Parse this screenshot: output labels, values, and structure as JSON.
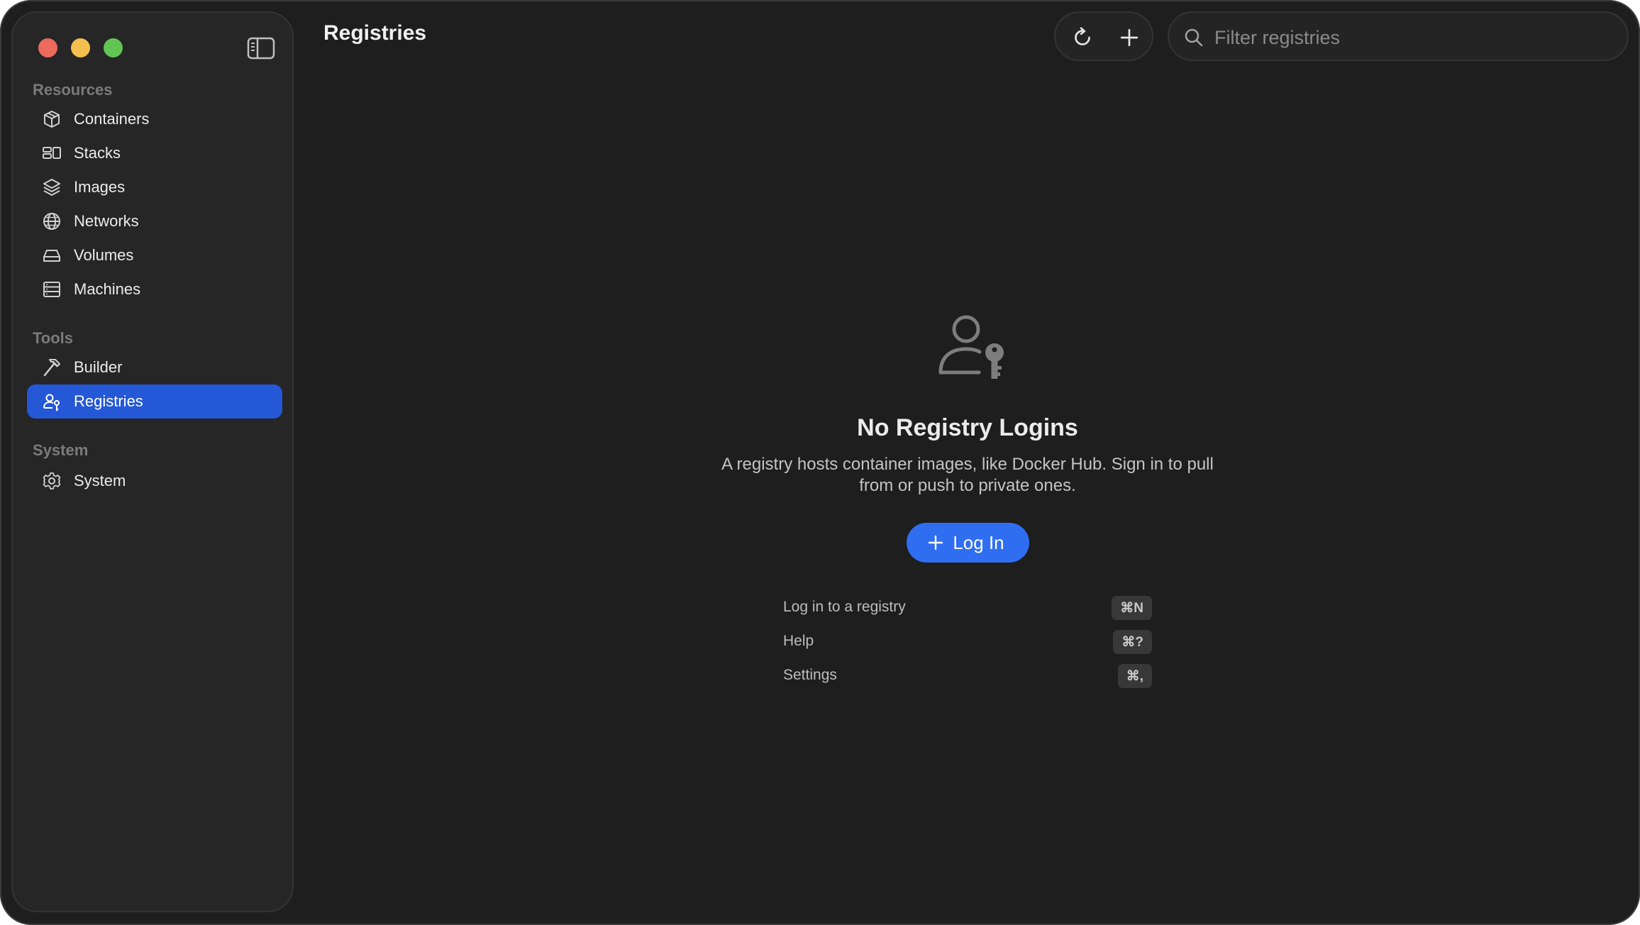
{
  "window": {
    "controls": [
      "close",
      "minimize",
      "zoom"
    ]
  },
  "sidebar": {
    "sections": [
      {
        "label": "Resources",
        "items": [
          {
            "label": "Containers",
            "icon": "box-icon"
          },
          {
            "label": "Stacks",
            "icon": "stacks-icon"
          },
          {
            "label": "Images",
            "icon": "layers-icon"
          },
          {
            "label": "Networks",
            "icon": "globe-icon"
          },
          {
            "label": "Volumes",
            "icon": "drive-icon"
          },
          {
            "label": "Machines",
            "icon": "server-icon"
          }
        ]
      },
      {
        "label": "Tools",
        "items": [
          {
            "label": "Builder",
            "icon": "hammer-icon"
          },
          {
            "label": "Registries",
            "icon": "person-key-icon",
            "active": true
          }
        ]
      },
      {
        "label": "System",
        "items": [
          {
            "label": "System",
            "icon": "gear-icon"
          }
        ]
      }
    ]
  },
  "header": {
    "title": "Registries",
    "search": {
      "placeholder": "Filter registries",
      "value": ""
    }
  },
  "empty_state": {
    "icon": "person-key-icon",
    "title": "No Registry Logins",
    "description_line1": "A registry hosts container images, like Docker Hub. Sign in to pull",
    "description_line2": "from or push to private ones.",
    "button_label": "Log In",
    "shortcuts": [
      {
        "label": "Log in to a registry",
        "key": "⌘N"
      },
      {
        "label": "Help",
        "key": "⌘?"
      },
      {
        "label": "Settings",
        "key": "⌘,"
      }
    ]
  },
  "colors": {
    "accent": "#2f6ef0",
    "sidebar_active": "#2458d6",
    "background": "#1e1e1e",
    "sidebar_bg": "#262626"
  }
}
